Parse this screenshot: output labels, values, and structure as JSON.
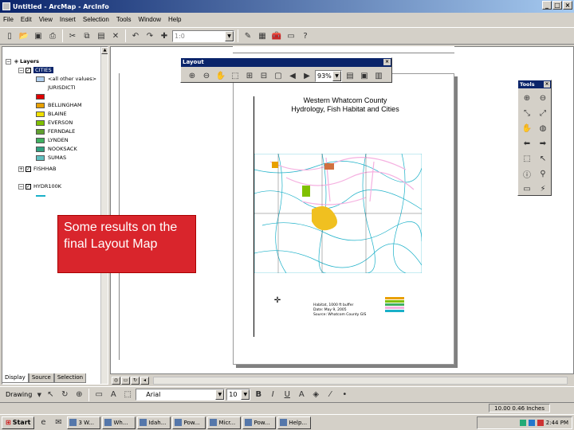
{
  "window": {
    "title": "Untitled - ArcMap - ArcInfo"
  },
  "menu": [
    "File",
    "Edit",
    "View",
    "Insert",
    "Selection",
    "Tools",
    "Window",
    "Help"
  ],
  "toolbar": {
    "scale_value": "1:0"
  },
  "toc": {
    "root_label": "Layers",
    "selected_layer": "CITIES",
    "other_values": "<all other values>",
    "field_label": "JURISDICTI",
    "jurisdictions": [
      {
        "name": "",
        "color": "#e00000"
      },
      {
        "name": "BELLINGHAM",
        "color": "#e8a000"
      },
      {
        "name": "BLAINE",
        "color": "#f0e000"
      },
      {
        "name": "EVERSON",
        "color": "#80c000"
      },
      {
        "name": "FERNDALE",
        "color": "#60a030"
      },
      {
        "name": "LYNDEN",
        "color": "#40b060"
      },
      {
        "name": "NOOKSACK",
        "color": "#30a080"
      },
      {
        "name": "SUMAS",
        "color": "#60c0c0"
      }
    ],
    "layer2": "FISHHAB",
    "layer3": "HYDR100K",
    "tabs": [
      "Display",
      "Source",
      "Selection"
    ]
  },
  "layout_toolbar": {
    "title": "Layout",
    "zoom_value": "93%"
  },
  "tools_toolbar": {
    "title": "Tools"
  },
  "map_page": {
    "title_line1": "Western Whatcom County",
    "title_line2": "Hydrology, Fish Habitat and Cities",
    "legend_line1": "Habitat, 1000 ft buffer",
    "legend_line2": "Date: May 9, 2005",
    "legend_line3": "Source: Whatcom County GIS"
  },
  "callout": {
    "line1": "Some results on the",
    "line2": "final Layout Map"
  },
  "drawing_toolbar": {
    "drawing_label": "Drawing",
    "font_value": "Arial",
    "size_value": "10"
  },
  "status": {
    "coords": "10.00  0.46 Inches"
  },
  "taskbar": {
    "start_label": "Start",
    "tasks": [
      "3 W...",
      "Wh...",
      "Idah...",
      "Pow...",
      "Micr...",
      "Pow...",
      "Help..."
    ],
    "clock": "2:44 PM"
  },
  "colors": {
    "callout_bg": "#d9252c",
    "title_bar": "#0a246a",
    "stream_color": "#1ab0c8",
    "habitat_color": "#f5b0e0"
  }
}
